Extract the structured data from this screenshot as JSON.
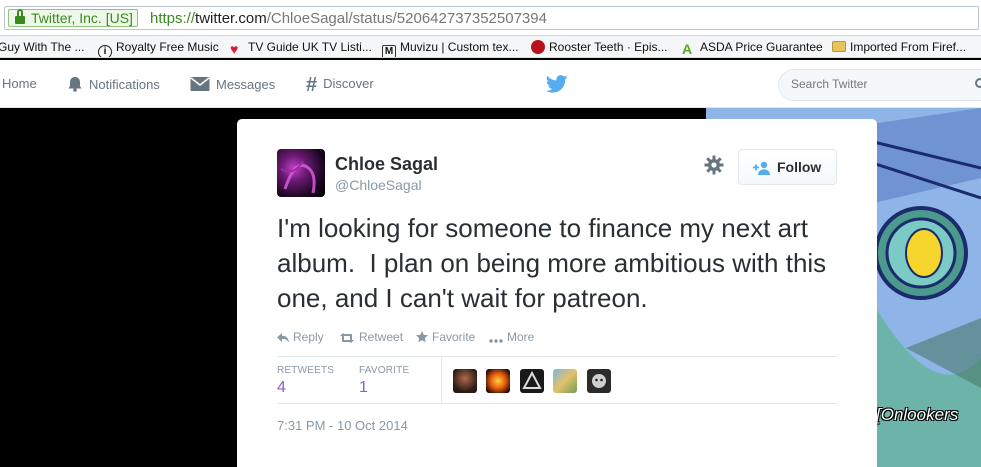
{
  "browser": {
    "identity_label": "Twitter, Inc. [US]",
    "url_scheme": "https://",
    "url_host": "twitter.com",
    "url_path": "/ChloeSagal/status/520642737352507394",
    "bookmarks": [
      {
        "label": "Guy With The ...",
        "icon": "page-icon",
        "color": "#888888"
      },
      {
        "label": "Royalty Free Music",
        "icon": "info-icon",
        "color": "#222222"
      },
      {
        "label": "TV Guide UK TV Listi...",
        "icon": "heart-icon",
        "color": "#d81b3a"
      },
      {
        "label": "Muvizu | Custom tex...",
        "icon": "m-icon",
        "color": "#333333"
      },
      {
        "label": "Rooster Teeth · Epis...",
        "icon": "rooster-icon",
        "color": "#b5121b"
      },
      {
        "label": "ASDA Price Guarantee",
        "icon": "asda-icon",
        "color": "#5aa81e"
      },
      {
        "label": "Imported From Firef...",
        "icon": "folder-icon",
        "color": "#e8c45c"
      }
    ]
  },
  "twitter_nav": {
    "home": "Home",
    "notifications": "Notifications",
    "messages": "Messages",
    "discover": "Discover",
    "search_placeholder": "Search Twitter"
  },
  "tweet": {
    "fullname": "Chloe Sagal",
    "handle": "@ChloeSagal",
    "follow_label": "Follow",
    "text": "I'm looking for someone to finance my next art album.  I plan on being more ambitious with this one, and I can't wait for patreon.",
    "actions": {
      "reply": "Reply",
      "retweet": "Retweet",
      "favorite": "Favorite",
      "more": "More"
    },
    "stats": {
      "retweets_label": "RETWEETS",
      "retweets_count": "4",
      "favorites_label": "FAVORITE",
      "favorites_count": "1"
    },
    "timestamp": "7:31 PM - 10 Oct 2014"
  },
  "background_caption": "[Onlookers",
  "colors": {
    "twitter_blue": "#55acee",
    "secure_green": "#3a8a1f",
    "stat_purple": "#8a5fc7"
  }
}
